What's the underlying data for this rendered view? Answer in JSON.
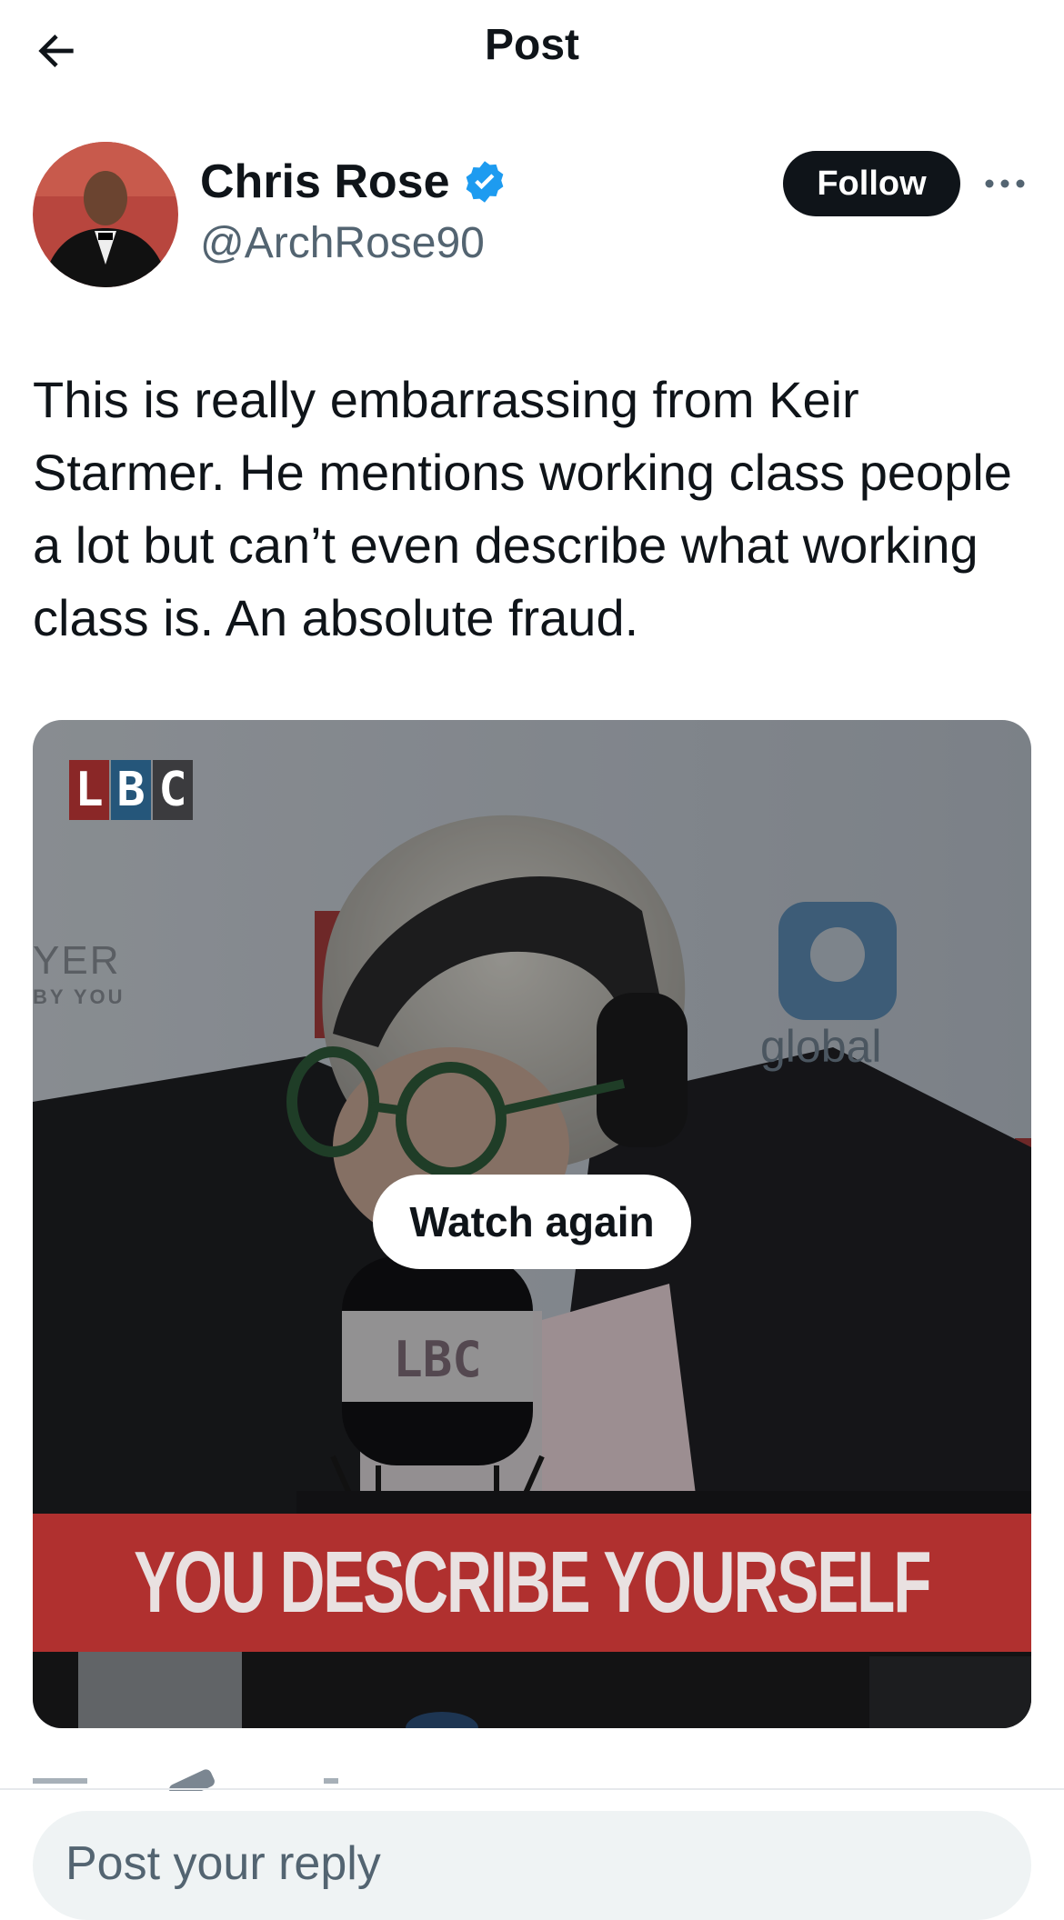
{
  "header": {
    "title": "Post"
  },
  "author": {
    "name": "Chris Rose",
    "handle": "@ArchRose90",
    "verified": true,
    "follow_label": "Follow"
  },
  "post": {
    "text": "This is really embarrassing from Keir Starmer. He mentions working class people a lot but can’t even describe what working class is. An absolute fraud."
  },
  "media": {
    "watch_again_label": "Watch again",
    "caption": "YOU DESCRIBE YOURSELF",
    "background_texts": {
      "er": "YER",
      "you": "BY YOU",
      "global": "global"
    },
    "logo_letters": [
      "L",
      "B",
      "C"
    ]
  },
  "reply": {
    "placeholder": "Post your reply"
  },
  "colors": {
    "accent": "#1d9bf0",
    "follow_bg": "#0f1419",
    "caption_bar": "#b0302f",
    "muted_text": "#536471"
  },
  "icons": [
    "back-arrow-icon",
    "verified-badge-icon",
    "more-options-icon"
  ]
}
